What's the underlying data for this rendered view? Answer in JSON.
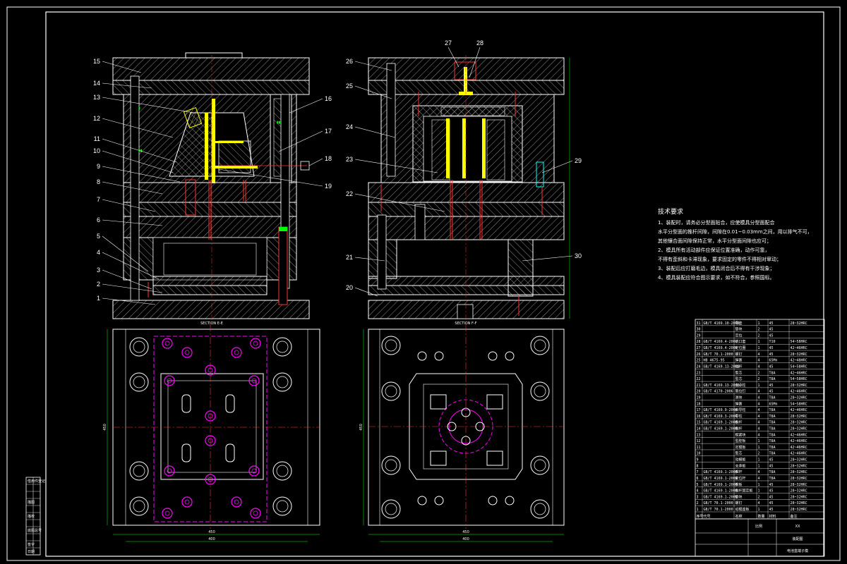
{
  "labels_left": [
    "15",
    "14",
    "13",
    "12",
    "11",
    "10",
    "9",
    "8",
    "7",
    "6",
    "5",
    "4",
    "3",
    "2",
    "1"
  ],
  "labels_right_a": [
    "16",
    "17",
    "18",
    "19"
  ],
  "labels_top_b": [
    "27",
    "28"
  ],
  "labels_left_b": [
    "26",
    "25",
    "24",
    "23",
    "22",
    "21",
    "20"
  ],
  "labels_right_b": [
    "29",
    "30"
  ],
  "section_a": "SECTION E-E",
  "section_b": "SECTION F-F",
  "dims": {
    "w1": "450",
    "w2": "400",
    "w3": "450",
    "w4": "400",
    "h1": "450",
    "h2": "450"
  },
  "tech": {
    "title": "技术要求",
    "lines": [
      "1、装配时，请务必分型面贴合，应使模具分型面配合",
      "  水平分型面的推杆间隙，间隙在0.01~0.03mm之间，用以排气不可，",
      "  其他镶合面间隙保持正常，水平分型面间隙也应可；",
      "2、模具所有活动部件应保证位置准确，动作可靠，",
      "  不得有歪斜和卡滞现象，要求固定的零件不得相对窜动；",
      "3、装配后应打磨毛边，模具闭合后不得有干涉现象；",
      "4、模具装配应符合图示要求，如不符合，参照国标。"
    ]
  },
  "bom": [
    [
      "31",
      "GB/T 4169.10-2006",
      "导套",
      "1",
      "45",
      "28~32HRC"
    ],
    [
      "30",
      "",
      "垫块",
      "2",
      "45",
      ""
    ],
    [
      "29",
      "",
      "定位",
      "2",
      "45",
      ""
    ],
    [
      "28",
      "GB/T 4169.4-2006",
      "浇口套",
      "1",
      "T10",
      "54~58HRC"
    ],
    [
      "27",
      "GB/T 4169.4-2006",
      "定位圈",
      "1",
      "45",
      "42~46HRC"
    ],
    [
      "26",
      "GB/T 70.1-2000",
      "螺钉",
      "4",
      "45",
      "28~32HRC"
    ],
    [
      "25",
      "HB 4675-95",
      "弹簧",
      "4",
      "65Mn",
      "42~48HRC"
    ],
    [
      "24",
      "GB/T 4169.13-2006",
      "拉杆",
      "4",
      "45",
      "54~58HRC"
    ],
    [
      "23",
      "",
      "型芯",
      "2",
      "T8A",
      "42~46HRC"
    ],
    [
      "22",
      "",
      "型芯",
      "2",
      "T8A",
      "54~58HRC"
    ],
    [
      "21",
      "GB/T 4169.13-2006",
      "支承柱",
      "1",
      "45",
      "28~32HRC"
    ],
    [
      "20",
      "GB/T 4170-2006",
      "限位钉",
      "4",
      "45",
      "42~46HRC"
    ],
    [
      "19",
      "",
      "滑块",
      "4",
      "T8A",
      "28~32HRC"
    ],
    [
      "18",
      "",
      "弹簧",
      "4",
      "65Mn",
      "54~58HRC"
    ],
    [
      "17",
      "GB/T 4169.9-2006",
      "斜导柱",
      "4",
      "T8A",
      "42~46HRC"
    ],
    [
      "16",
      "GB/T 4169.3-2006",
      "导柱",
      "4",
      "T8A",
      "28~32HRC"
    ],
    [
      "15",
      "GB/T 4169.1-2006",
      "推杆",
      "4",
      "T8A",
      "28~32HRC"
    ],
    [
      "14",
      "GB/T 4169.1-2006",
      "推杆",
      "4",
      "T8A",
      "28~32HRC"
    ],
    [
      "13",
      "",
      "楔紧块",
      "4",
      "T8A",
      "42~46HRC"
    ],
    [
      "12",
      "",
      "型腔板",
      "1",
      "T8A",
      "42~46HRC"
    ],
    [
      "11",
      "",
      "定模板",
      "1",
      "T8A",
      "42~46HRC"
    ],
    [
      "10",
      "",
      "型芯",
      "2",
      "T8A",
      "42~46HRC"
    ],
    [
      "9",
      "",
      "动模板",
      "1",
      "45",
      "28~32HRC"
    ],
    [
      "8",
      "",
      "支承板",
      "1",
      "45",
      "28~32HRC"
    ],
    [
      "7",
      "GB/T 4169.1-2006",
      "推杆",
      "4",
      "T8A",
      "28~32HRC"
    ],
    [
      "6",
      "GB/T 4169.1-2006",
      "复位杆",
      "4",
      "T8A",
      "28~32HRC"
    ],
    [
      "5",
      "GB/T 4169.1-2006",
      "推板",
      "1",
      "45",
      "28~32HRC"
    ],
    [
      "4",
      "GB/T 4169.1-2006",
      "推杆固定板",
      "1",
      "45",
      "28~32HRC"
    ],
    [
      "3",
      "GB/T 4169.1-2006",
      "垫块",
      "2",
      "45",
      "28~32HRC"
    ],
    [
      "2",
      "GB/T 70.1-2000",
      "螺钉",
      "4",
      "45",
      "28~32HRC"
    ],
    [
      "1",
      "GB/T 70.1-2000",
      "动模座板",
      "1",
      "45",
      "28~32HRC"
    ]
  ],
  "bom_header": [
    "序号",
    "代号",
    "名称",
    "数量",
    "材料",
    "备注"
  ],
  "title_block": {
    "name": "装配图",
    "drawing": "电池盒端子模",
    "school": "XX",
    "scale": "比例"
  },
  "strip": [
    "借用件登记",
    "",
    "",
    "描图",
    "",
    "描校",
    "",
    "底图总号",
    "",
    "签字",
    "日期"
  ],
  "colors": {
    "line": "#ffffff",
    "hatch": "#e8e8e8",
    "yellow": "#ffff00",
    "magenta": "#ff00ff",
    "red": "#ff2020",
    "green": "#00ff00",
    "cyan": "#00ffff"
  }
}
